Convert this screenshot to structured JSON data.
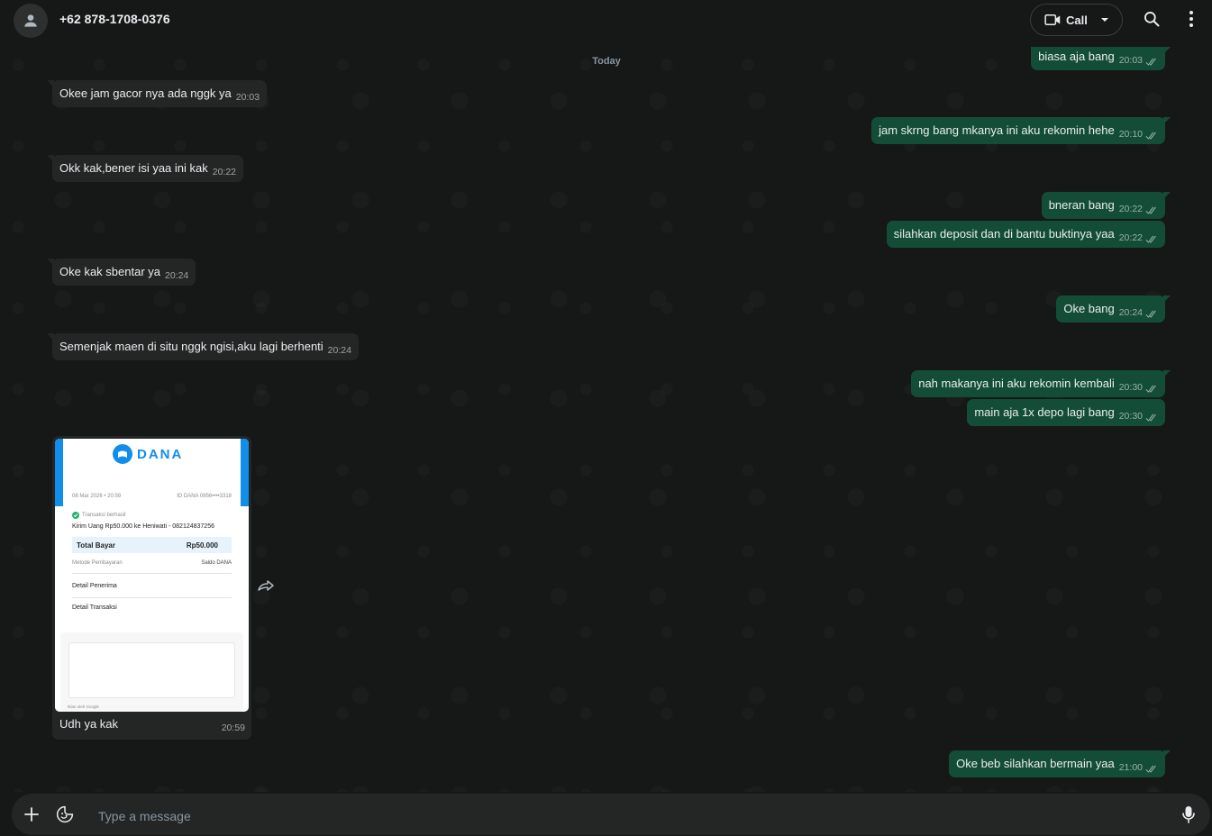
{
  "header": {
    "contact_name": "+62 878-1708-0376",
    "call_label": "Call"
  },
  "chat": {
    "date_divider": "Today",
    "incoming": [
      {
        "text": "Okee jam gacor nya ada nggk ya",
        "time": "20:03"
      },
      {
        "text": "Okk kak,bener isi yaa ini kak",
        "time": "20:22"
      },
      {
        "text": "Oke kak sbentar ya",
        "time": "20:24"
      },
      {
        "text": "Semenjak maen di situ nggk ngisi,aku lagi berhenti",
        "time": "20:24"
      }
    ],
    "outgoing": [
      {
        "text": "biasa aja bang",
        "time": "20:03"
      },
      {
        "text": "jam skrng bang mkanya ini aku rekomin hehe",
        "time": "20:10"
      },
      {
        "text": "bneran bang",
        "time": "20:22"
      },
      {
        "text": "silahkan deposit dan di bantu buktinya yaa",
        "time": "20:22"
      },
      {
        "text": "Oke bang",
        "time": "20:24"
      },
      {
        "text": "nah makanya ini aku rekomin kembali",
        "time": "20:30"
      },
      {
        "text": "main aja 1x depo lagi bang",
        "time": "20:30"
      },
      {
        "text": "Oke beb silahkan bermain yaa",
        "time": "21:00"
      }
    ],
    "image_message": {
      "caption": "Udh ya kak",
      "time": "20:59",
      "receipt": {
        "brand": "DANA",
        "date": "08 Mar 2026 • 20:59",
        "id": "ID DANA 0856••••3318",
        "status": "Transaksi berhasil",
        "description": "Kirim Uang Rp50.000 ke Heniwati - 082124837256",
        "total_label": "Total Bayar",
        "total_value": "Rp50.000",
        "method_label": "Metode Pembayaran",
        "method_value": "Saldo DANA",
        "recipient_label": "Detail Penerima",
        "transaction_label": "Detail Transaksi",
        "footer_note": "Iklan oleh Google"
      }
    }
  },
  "composer": {
    "placeholder": "Type a message"
  },
  "colors": {
    "background": "#161717",
    "incoming_bubble": "#242626",
    "outgoing_bubble": "#144d37",
    "dana_blue": "#108ee9"
  }
}
